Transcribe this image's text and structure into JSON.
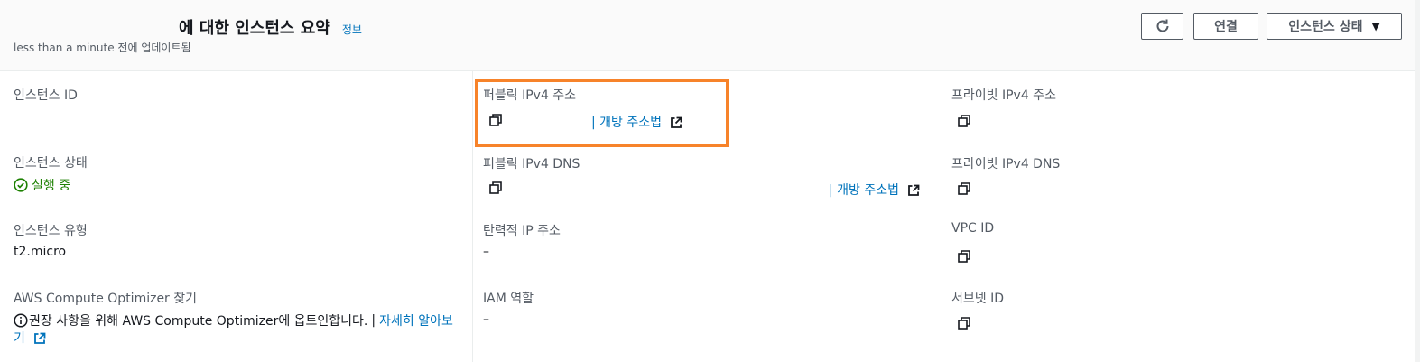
{
  "header": {
    "title": "에 대한 인스턴스 요약",
    "info_link": "정보",
    "updated": "less than a minute 전에 업데이트됨",
    "connect_button": "연결",
    "instance_state_button": "인스턴스 상태",
    "icons": {
      "refresh": "refresh-icon",
      "caret": "caret-down-icon"
    }
  },
  "col1": {
    "instance_id_label": "인스턴스 ID",
    "instance_state_label": "인스턴스 상태",
    "instance_state_value": "실행 중",
    "instance_type_label": "인스턴스 유형",
    "instance_type_value": "t2.micro",
    "optimizer_label": "AWS Compute Optimizer 찾기",
    "optimizer_text": "권장 사항을 위해 AWS Compute Optimizer에 옵트인합니다.",
    "optimizer_sep": "|",
    "optimizer_link_1": "자세히 알아보",
    "optimizer_link_2": "기"
  },
  "col2": {
    "public_ipv4_label": "퍼블릭 IPv4 주소",
    "open_address_link": "개방 주소법",
    "sep": "|",
    "public_dns_label": "퍼블릭 IPv4 DNS",
    "open_address_link_2": "개방 주소법",
    "elastic_ip_label": "탄력적 IP 주소",
    "elastic_ip_value": "–",
    "iam_role_label": "IAM 역할",
    "iam_role_value": "–"
  },
  "col3": {
    "private_ipv4_label": "프라이빗 IPv4 주소",
    "private_dns_label": "프라이빗 IPv4 DNS",
    "vpc_id_label": "VPC ID",
    "subnet_id_label": "서브넷 ID"
  },
  "colors": {
    "link": "#0073bb",
    "running": "#1d8102",
    "highlight": "#f7832a",
    "label": "#545b64"
  }
}
